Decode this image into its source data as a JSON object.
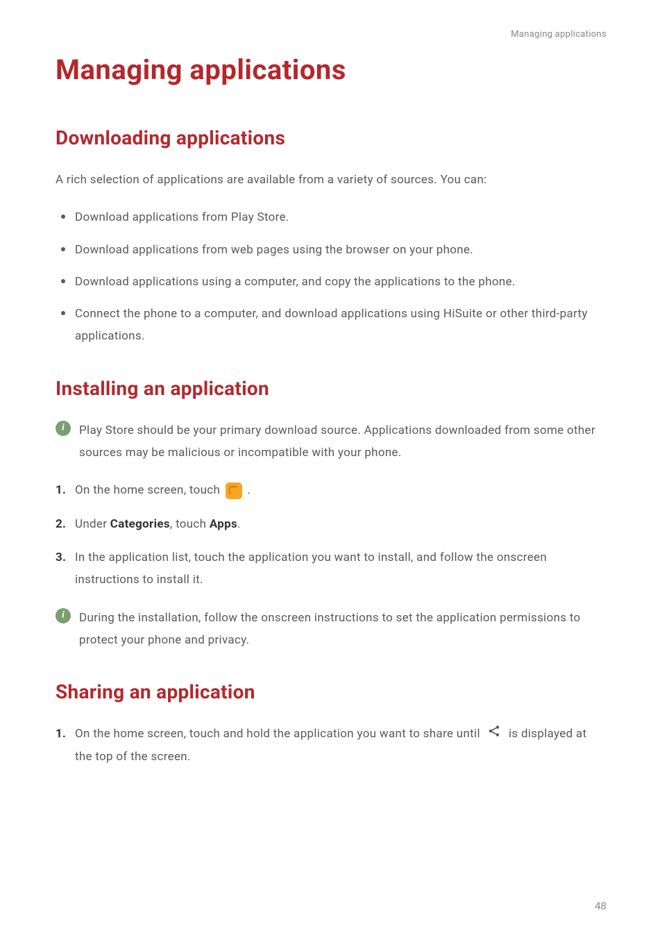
{
  "header": {
    "running_title": "Managing applications"
  },
  "title": "Managing applications",
  "sections": {
    "downloading": {
      "heading": "Downloading applications",
      "intro": "A rich selection of applications are available from a variety of sources. You can:",
      "bullets": [
        "Download applications from Play Store.",
        "Download applications from web pages using the browser on your phone.",
        "Download applications using a computer, and copy the applications to the phone.",
        "Connect the phone to a computer, and download applications using HiSuite or other third-party applications."
      ]
    },
    "installing": {
      "heading": "Installing an application",
      "info1": "Play Store should be your primary download source. Applications downloaded from some other sources may be malicious or incompatible with your phone.",
      "steps": {
        "s1_pre": "On the home screen, touch ",
        "s1_post": ".",
        "s2_pre": "Under ",
        "s2_cat": "Categories",
        "s2_mid": ", touch ",
        "s2_apps": "Apps",
        "s2_post": ".",
        "s3": "In the application list, touch the application you want to install, and follow the onscreen instructions to install it."
      },
      "info2": "During the installation, follow the onscreen instructions to set the application permissions to protect your phone and privacy."
    },
    "sharing": {
      "heading": "Sharing an application",
      "steps": {
        "s1_pre": "On the home screen, touch and hold the application you want to share until ",
        "s1_post": " is displayed at the top of the screen."
      }
    }
  },
  "page_number": "48"
}
